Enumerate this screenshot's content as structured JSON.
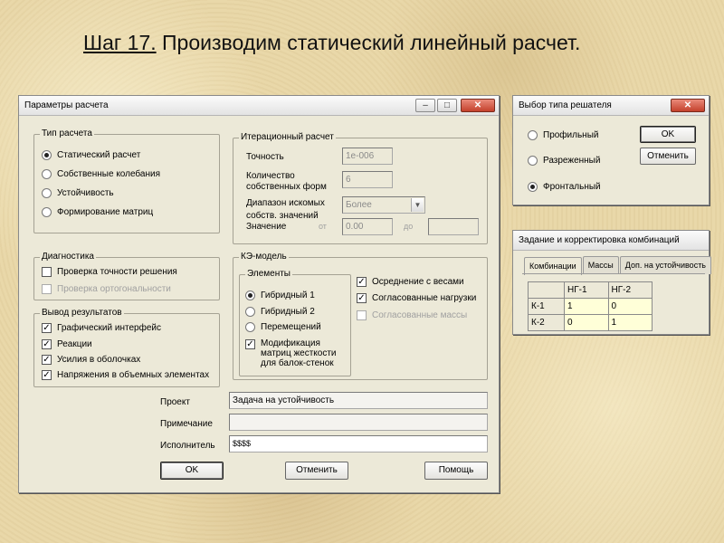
{
  "slide": {
    "title_step": "Шаг 17.",
    "title_rest": " Производим статический линейный расчет."
  },
  "params_window": {
    "title": "Параметры расчета",
    "controls": {
      "minimize": "–",
      "maximize": "□",
      "close": "✕"
    },
    "calc_type": {
      "legend": "Тип расчета",
      "options": [
        "Статический расчет",
        "Собственные колебания",
        "Устойчивость",
        "Формирование матриц"
      ],
      "selected": 0
    },
    "iter": {
      "legend": "Итерационный расчет",
      "precision_label": "Точность",
      "precision_value": "1e-006",
      "modes_label_1": "Количество",
      "modes_label_2": "собственных форм",
      "modes_value": "6",
      "range_label_1": "Диапазон искомых",
      "range_label_2": "собств. значений",
      "range_value": "Более",
      "value_label": "Значение",
      "from_label": "от",
      "from_value": "0.00",
      "to_label": "до",
      "to_value": ""
    },
    "diag": {
      "legend": "Диагностика",
      "check_precision": "Проверка точности решения",
      "check_ortho": "Проверка ортогональности"
    },
    "output": {
      "legend": "Вывод результатов",
      "items": [
        "Графический интерфейс",
        "Реакции",
        "Усилия в оболочках",
        "Напряжения в объемных элементах"
      ]
    },
    "ke": {
      "legend": "КЭ-модель",
      "elements_legend": "Элементы",
      "hybrid1": "Гибридный 1",
      "hybrid2": "Гибридный 2",
      "displacements": "Перемещений",
      "mod_1": "Модификация",
      "mod_2": "матриц жесткости",
      "mod_3": "для балок-стенок",
      "averaging": "Осреднение с весами",
      "consistent_loads": "Согласованные нагрузки",
      "consistent_masses": "Согласованные массы"
    },
    "project_label": "Проект",
    "project_value": "Задача на устойчивость",
    "note_label": "Примечание",
    "note_value": "",
    "author_label": "Исполнитель",
    "author_value": "$$$$",
    "ok": "OK",
    "cancel": "Отменить",
    "help": "Помощь"
  },
  "solver_window": {
    "title": "Выбор типа решателя",
    "close": "✕",
    "options": [
      "Профильный",
      "Разреженный",
      "Фронтальный"
    ],
    "selected": 2,
    "ok": "OK",
    "cancel": "Отменить"
  },
  "comb_window": {
    "title": "Задание и корректировка комбинаций",
    "tabs": [
      "Комбинации",
      "Массы",
      "Доп. на устойчивость"
    ],
    "columns": [
      "НГ-1",
      "НГ-2"
    ],
    "rows": [
      {
        "name": "К-1",
        "values": [
          "1",
          "0"
        ]
      },
      {
        "name": "К-2",
        "values": [
          "0",
          "1"
        ]
      }
    ]
  }
}
